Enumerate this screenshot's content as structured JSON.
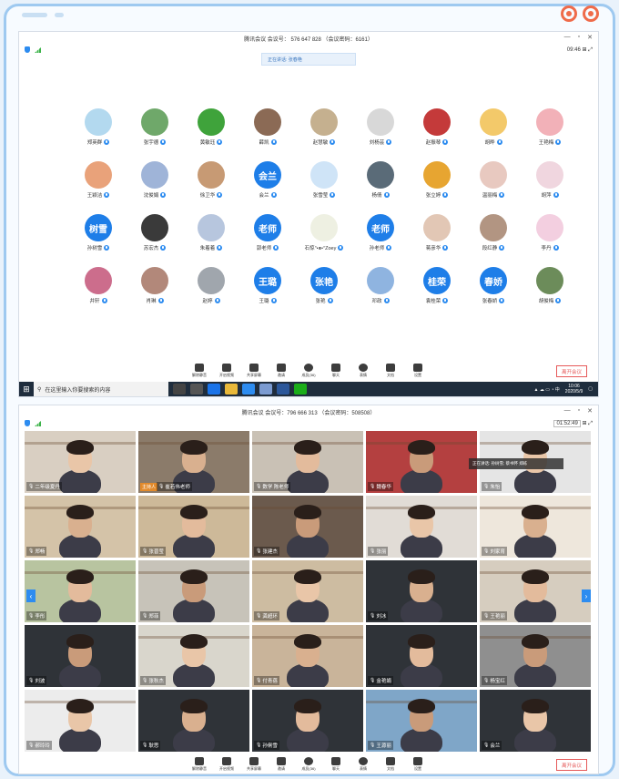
{
  "top": {
    "title": "腾讯会议 会议号： 576 647 828 （会议密码：6161）",
    "time": "09:46",
    "speaking": "正在讲话: 张春艳",
    "participants": [
      {
        "name": "郑英群",
        "color": "#b3d9ef",
        "text": ""
      },
      {
        "name": "张宇德",
        "color": "#6fa86a",
        "text": ""
      },
      {
        "name": "黄敏珏",
        "color": "#3fa33b",
        "text": ""
      },
      {
        "name": "薛凯",
        "color": "#8b6a55",
        "text": ""
      },
      {
        "name": "赵慧敏",
        "color": "#c5b08f",
        "text": ""
      },
      {
        "name": "刘杨芸",
        "color": "#d8d8d8",
        "text": ""
      },
      {
        "name": "赵振琴",
        "color": "#c43a3a",
        "text": ""
      },
      {
        "name": "胡晔",
        "color": "#f3c96a",
        "text": ""
      },
      {
        "name": "王艳梅",
        "color": "#f2b1b8",
        "text": ""
      },
      {
        "name": "王颖洁",
        "color": "#e9a27a",
        "text": ""
      },
      {
        "name": "沈俊娟",
        "color": "#9fb4d8",
        "text": ""
      },
      {
        "name": "徐卫华",
        "color": "#c79a74",
        "text": ""
      },
      {
        "name": "会兰",
        "color": "#1e7ee8",
        "text": "会兰"
      },
      {
        "name": "张雪莹",
        "color": "#cfe4f7",
        "text": ""
      },
      {
        "name": "杨倩",
        "color": "#5a6b78",
        "text": ""
      },
      {
        "name": "张立婷",
        "color": "#e7a531",
        "text": ""
      },
      {
        "name": "温丽梅",
        "color": "#e8c9c0",
        "text": ""
      },
      {
        "name": "胡萍",
        "color": "#f0d6df",
        "text": ""
      },
      {
        "name": "孙树雪",
        "color": "#1e7ee8",
        "text": "树雪"
      },
      {
        "name": "苏宏杰",
        "color": "#3a3a3a",
        "text": ""
      },
      {
        "name": "朱着着",
        "color": "#b7c6de",
        "text": ""
      },
      {
        "name": "郭老师",
        "color": "#1e7ee8",
        "text": "老师"
      },
      {
        "name": "石惊ᐢ•ᴥ•ᐢZoey",
        "color": "#eef0e2",
        "text": ""
      },
      {
        "name": "孙老师",
        "color": "#1e7ee8",
        "text": "老师"
      },
      {
        "name": "蒋彦华",
        "color": "#e2c7b5",
        "text": ""
      },
      {
        "name": "段红静",
        "color": "#b29582",
        "text": ""
      },
      {
        "name": "李丹",
        "color": "#f3cfe0",
        "text": ""
      },
      {
        "name": "井轩",
        "color": "#cc6d8c",
        "text": ""
      },
      {
        "name": "肖琳",
        "color": "#b2887a",
        "text": ""
      },
      {
        "name": "赵婷",
        "color": "#a0a6ad",
        "text": ""
      },
      {
        "name": "王璐",
        "color": "#1e7ee8",
        "text": "王璐"
      },
      {
        "name": "张艳",
        "color": "#1e7ee8",
        "text": "张艳"
      },
      {
        "name": "邓政",
        "color": "#8fb4e0",
        "text": ""
      },
      {
        "name": "袁桂荣",
        "color": "#1e7ee8",
        "text": "桂荣"
      },
      {
        "name": "张春娇",
        "color": "#1e7ee8",
        "text": "春娇"
      },
      {
        "name": "胡俊梅",
        "color": "#6c8c5a",
        "text": ""
      }
    ]
  },
  "toolbar": {
    "items": [
      "解除静音",
      "开启视频",
      "共享屏幕",
      "邀请",
      "成员(36)",
      "聊天",
      "表情",
      "文档",
      "设置"
    ],
    "leave": "离开会议"
  },
  "taskbar": {
    "search_placeholder": "在这里输入你要搜索的内容",
    "time": "10:06",
    "date": "2020/5/9"
  },
  "bottom": {
    "title": "腾讯会议 会议号：796 666 313 （会议密码：508508）",
    "time": "01:52:49",
    "toast": "正在讲话: 孙树雪; 蔡书怀 郑栋",
    "host_label": "主持人",
    "tiles": [
      {
        "name": "二年级夏丹",
        "bg": "#d9cfc2"
      },
      {
        "name": "崔若伟老师",
        "bg": "#8b7b6a",
        "host": true
      },
      {
        "name": "数学 陈老师",
        "bg": "#c9c1b5"
      },
      {
        "name": "魏春华",
        "bg": "#b44040"
      },
      {
        "name": "朱怡",
        "bg": "#e5e5e5"
      },
      {
        "name": "郑畅",
        "bg": "#d4c3a8"
      },
      {
        "name": "张晋莹",
        "bg": "#cdb999"
      },
      {
        "name": "张建杰",
        "bg": "#6b5a4d"
      },
      {
        "name": "张丽",
        "bg": "#e1dcd6"
      },
      {
        "name": "刘家育",
        "bg": "#eee7dc"
      },
      {
        "name": "李彤",
        "bg": "#b8c4a0"
      },
      {
        "name": "郑菲",
        "bg": "#c7c3b9"
      },
      {
        "name": "龚超环",
        "bg": "#cdbca1"
      },
      {
        "name": "刘冰",
        "bg": "#2f3338"
      },
      {
        "name": "王艳丽",
        "bg": "#d6cdbf"
      },
      {
        "name": "刘波",
        "bg": "#2f3338"
      },
      {
        "name": "张秋杰",
        "bg": "#d9d6cc"
      },
      {
        "name": "付青蓓",
        "bg": "#c9b49a"
      },
      {
        "name": "金艳娟",
        "bg": "#2f3338"
      },
      {
        "name": "杨宝红",
        "bg": "#8f8f8f"
      },
      {
        "name": "郝玲玲",
        "bg": "#ececec"
      },
      {
        "name": "耿思",
        "bg": "#2f3338"
      },
      {
        "name": "孙俐雪",
        "bg": "#2f3338"
      },
      {
        "name": "王源丽",
        "bg": "#7fa6c8"
      },
      {
        "name": "会兰",
        "bg": "#2f3338"
      }
    ]
  },
  "colors": {
    "accent": "#2d8cf0",
    "leave": "#e65a5a",
    "frame": "#9ec9f0",
    "deco": "#ef6b4a"
  }
}
